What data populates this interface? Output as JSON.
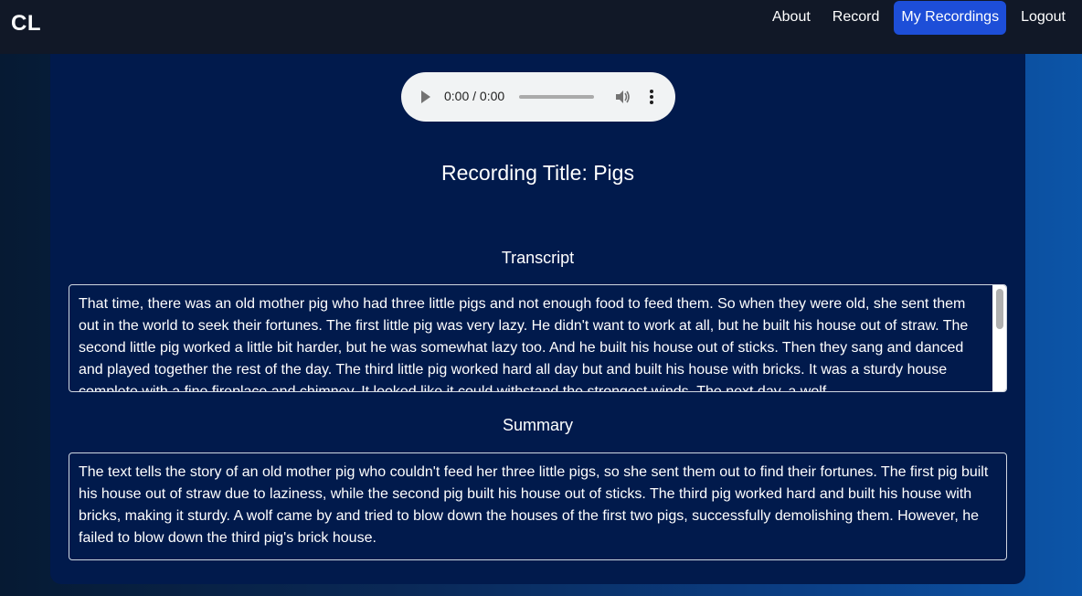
{
  "header": {
    "brand": "CL",
    "nav": [
      "About",
      "Record",
      "My Recordings",
      "Logout"
    ],
    "active": "My Recordings"
  },
  "player": {
    "time": "0:00 / 0:00",
    "progress": 0
  },
  "recording": {
    "title": "Recording Title: Pigs",
    "transcript_label": "Transcript",
    "transcript": "That time, there was an old mother pig who had three little pigs and not enough food to feed them. So when they were old, she sent them out in the world to seek their fortunes. The first little pig was very lazy. He didn't want to work at all, but he built his house out of straw. The second little pig worked a little bit harder, but he was somewhat lazy too. And he built his house out of sticks. Then they sang and danced and played together the rest of the day. The third little pig worked hard all day but and built his house with bricks. It was a sturdy house complete with a fine fireplace and chimney. It looked like it could withstand the strongest winds. The next day, a wolf",
    "summary_label": "Summary",
    "summary": "The text tells the story of an old mother pig who couldn't feed her three little pigs, so she sent them out to find their fortunes. The first pig built his house out of straw due to laziness, while the second pig built his house out of sticks. The third pig worked hard and built his house with bricks, making it sturdy. A wolf came by and tried to blow down the houses of the first two pigs, successfully demolishing them. However, he failed to blow down the third pig's brick house."
  }
}
